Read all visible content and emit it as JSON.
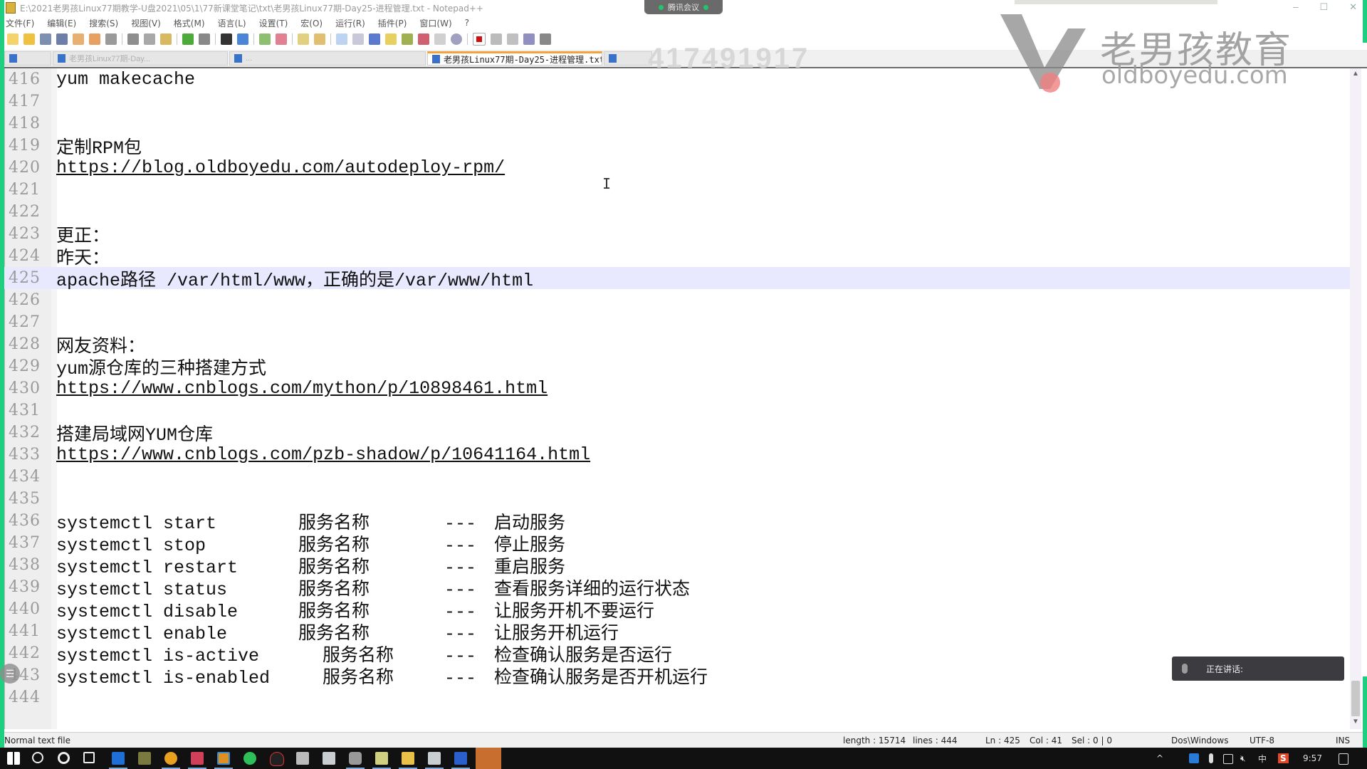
{
  "window": {
    "title": "E:\\2021老男孩Linux77期教学-U盘2021\\05\\1\\77新课堂笔记\\txt\\老男孩Linux77期-Day25-进程管理.txt - Notepad++",
    "controls": {
      "minimize": "–",
      "maximize": "☐",
      "close": "✕"
    }
  },
  "meeting_widget": {
    "label": "腾讯会议"
  },
  "menu": [
    "文件(F)",
    "编辑(E)",
    "搜索(S)",
    "视图(V)",
    "格式(M)",
    "语言(L)",
    "设置(T)",
    "宏(O)",
    "运行(R)",
    "插件(P)",
    "窗口(W)",
    "?"
  ],
  "toolbar": {
    "buttons": [
      "new-file",
      "open-file",
      "save",
      "save-all",
      "close",
      "close-all",
      "print",
      "cut",
      "copy",
      "paste",
      "undo",
      "redo",
      "find",
      "replace",
      "zoom-in",
      "zoom-out",
      "sync-vertical",
      "sync-horizontal",
      "word-wrap",
      "show-all-chars",
      "indent-guide",
      "user-defined-lang",
      "doc-map",
      "function-list",
      "folder-as-workspace",
      "monitoring",
      "record-macro",
      "stop-record",
      "play-macro",
      "run-macro-multiple",
      "save-macro"
    ]
  },
  "tabs": [
    {
      "label": "",
      "active": false
    },
    {
      "label": "老男孩Linux77期-Day...",
      "active": false
    },
    {
      "label": "...",
      "active": false
    },
    {
      "label": "老男孩Linux77期-Day25-进程管理.txt",
      "active": true
    },
    {
      "label": "",
      "active": false
    }
  ],
  "overlay_text": "417491917",
  "watermark": {
    "cn": "老男孩教育",
    "en": "oldboyedu.com"
  },
  "editor": {
    "current_line": 425,
    "lines": [
      {
        "n": "416",
        "text": "yum makecache"
      },
      {
        "n": "417",
        "text": ""
      },
      {
        "n": "418",
        "text": ""
      },
      {
        "n": "419",
        "text": "定制RPM包"
      },
      {
        "n": "420",
        "text": "https://blog.oldboyedu.com/autodeploy-rpm/",
        "link": true
      },
      {
        "n": "421",
        "text": ""
      },
      {
        "n": "422",
        "text": ""
      },
      {
        "n": "423",
        "text": "更正："
      },
      {
        "n": "424",
        "text": "昨天："
      },
      {
        "n": "425",
        "text": "apache路径 /var/html/www，正确的是/var/www/html"
      },
      {
        "n": "426",
        "text": ""
      },
      {
        "n": "427",
        "text": ""
      },
      {
        "n": "428",
        "text": "网友资料："
      },
      {
        "n": "429",
        "text": "yum源仓库的三种搭建方式"
      },
      {
        "n": "430",
        "text": "https://www.cnblogs.com/mython/p/10898461.html",
        "link": true
      },
      {
        "n": "431",
        "text": ""
      },
      {
        "n": "432",
        "text": "搭建局域网YUM仓库"
      },
      {
        "n": "433",
        "text": "https://www.cnblogs.com/pzb-shadow/p/10641164.html",
        "link": true
      },
      {
        "n": "434",
        "text": ""
      },
      {
        "n": "435",
        "text": ""
      }
    ],
    "systemctl_rows": [
      {
        "n": "436",
        "cmd": "systemctl start",
        "arg": "服务名称",
        "sep": "---",
        "desc": "启动服务"
      },
      {
        "n": "437",
        "cmd": "systemctl stop",
        "arg": "服务名称",
        "sep": "---",
        "desc": "停止服务"
      },
      {
        "n": "438",
        "cmd": "systemctl restart",
        "arg": "服务名称",
        "sep": "---",
        "desc": "重启服务"
      },
      {
        "n": "439",
        "cmd": "systemctl status",
        "arg": "服务名称",
        "sep": "---",
        "desc": "查看服务详细的运行状态"
      },
      {
        "n": "440",
        "cmd": "systemctl disable",
        "arg": "服务名称",
        "sep": "---",
        "desc": "让服务开机不要运行"
      },
      {
        "n": "441",
        "cmd": "systemctl enable",
        "arg": "服务名称",
        "sep": "---",
        "desc": "让服务开机运行"
      },
      {
        "n": "442",
        "cmd": "systemctl is-active",
        "arg": "服务名称",
        "sep": "---",
        "desc": "检查确认服务是否运行",
        "wide": true
      },
      {
        "n": "443",
        "cmd": "systemctl is-enabled",
        "arg": "服务名称",
        "sep": "---",
        "desc": "检查确认服务是否开机运行",
        "wide": true
      }
    ],
    "last_line": {
      "n": "444",
      "text": ""
    }
  },
  "speaking_popup": {
    "label": "正在讲话:"
  },
  "statusbar": {
    "file_type": "Normal text file",
    "length": "length : 15714",
    "lines": "lines : 444",
    "ln": "Ln : 425",
    "col": "Col : 41",
    "sel": "Sel : 0 | 0",
    "eol": "Dos\\Windows",
    "encoding": "UTF-8",
    "mode": "INS"
  },
  "taskbar": {
    "apps": [
      "start",
      "search",
      "cortana",
      "task-view",
      "app-blue",
      "app-figure",
      "chrome",
      "app-red",
      "app-frame",
      "wechat",
      "qq",
      "app-monitor",
      "app-doc1",
      "app-camera",
      "notepad",
      "file-explorer",
      "app-doc2",
      "word",
      "notepad-plus-plus"
    ],
    "tray": {
      "ime": "中",
      "sogou": "S",
      "time": "9:57",
      "chevron": "^"
    }
  },
  "colors": {
    "accent_green": "#1fcf7f",
    "tab_active_border": "#f2a43a",
    "current_line_bg": "#e8e8ff"
  }
}
